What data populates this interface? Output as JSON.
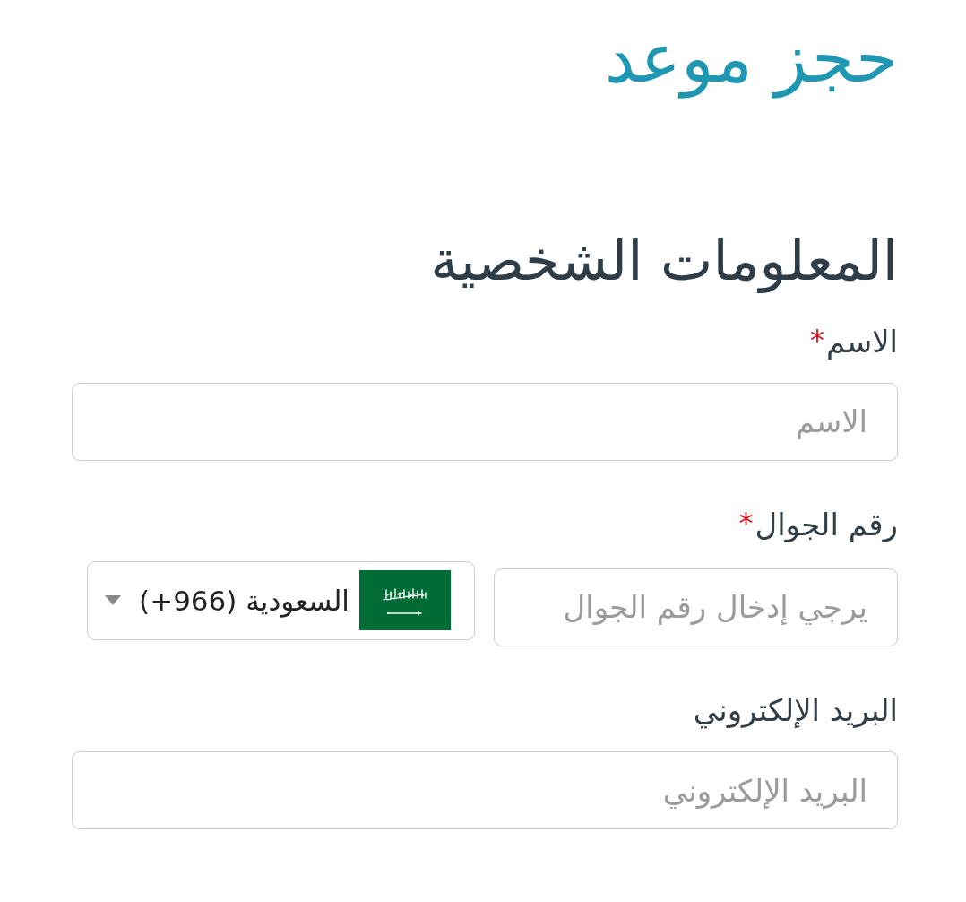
{
  "title": "حجز موعد",
  "section_title": "المعلومات الشخصية",
  "fields": [
    {
      "kind": "text",
      "label": "الاسم",
      "required_mark": "*",
      "placeholder": "الاسم"
    },
    {
      "kind": "phone",
      "label": "رقم الجوال",
      "required_mark": "*",
      "placeholder": "يرجي إدخال رقم الجوال",
      "country": {
        "label": "(+966) السعودية"
      }
    },
    {
      "kind": "text",
      "label": "البريد الإلكتروني",
      "placeholder": "البريد الإلكتروني"
    }
  ]
}
